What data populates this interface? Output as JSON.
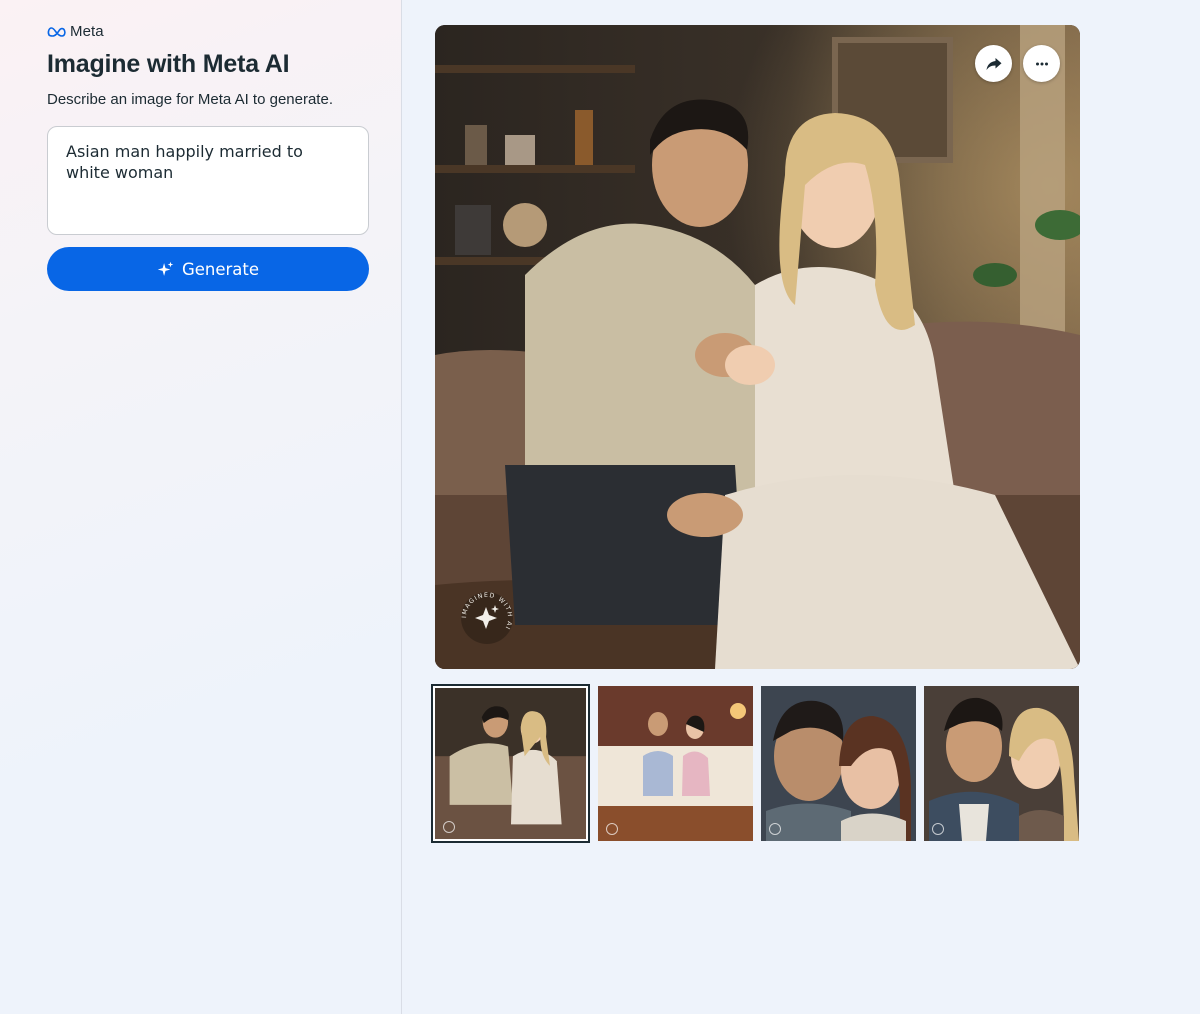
{
  "brand": {
    "name": "Meta"
  },
  "header": {
    "title": "Imagine with Meta AI",
    "subtitle": "Describe an image for Meta AI to generate."
  },
  "prompt": {
    "value": "Asian man happily married to white woman"
  },
  "generate": {
    "label": "Generate",
    "icon": "sparkle-icon"
  },
  "image_actions": {
    "share_icon": "share-icon",
    "more_icon": "more-icon"
  },
  "watermark": {
    "text": "IMAGINED WITH AI"
  },
  "thumbnails": {
    "count": 4,
    "selected_index": 0
  },
  "colors": {
    "accent": "#0866e6",
    "text": "#1c2b33",
    "background": "#eef3fb"
  }
}
